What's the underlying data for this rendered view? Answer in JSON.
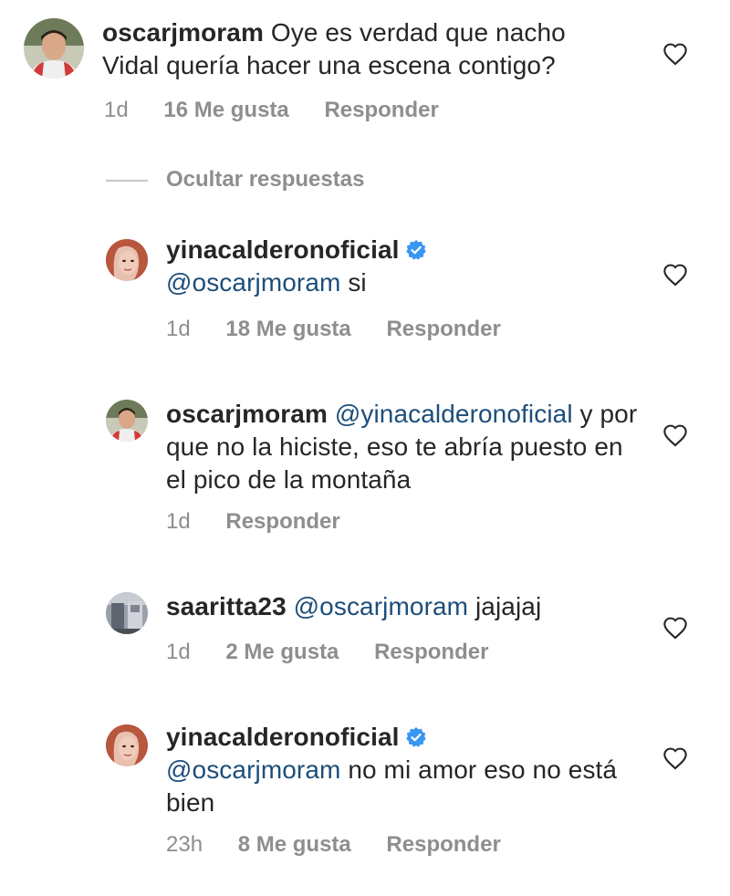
{
  "comments": [
    {
      "username": "oscarjmoram",
      "text": "Oye es verdad que nacho Vidal quería hacer una escena contigo?",
      "time": "1d",
      "likes": "16 Me gusta",
      "reply": "Responder"
    },
    {
      "username": "yinacalderonoficial",
      "mention": "@oscarjmoram",
      "text": " si",
      "time": "1d",
      "likes": "18 Me gusta",
      "reply": "Responder"
    },
    {
      "username": "oscarjmoram",
      "mention": "@yinacalderonoficial",
      "text": "y por que no la hiciste, eso te abría puesto en el pico de la montaña",
      "time": "1d",
      "reply": "Responder"
    },
    {
      "username": "saaritta23",
      "mention": "@oscarjmoram",
      "text": " jajajaj",
      "time": "1d",
      "likes": "2 Me gusta",
      "reply": "Responder"
    },
    {
      "username": "yinacalderonoficial",
      "mention": "@oscarjmoram",
      "text": " no mi amor eso no está bien",
      "time": "23h",
      "likes": "8 Me gusta",
      "reply": "Responder"
    }
  ],
  "hide_replies": "Ocultar respuestas",
  "colors": {
    "mention": "#1d4e7a",
    "meta": "#8e8e8e",
    "verified": "#3897f0"
  }
}
